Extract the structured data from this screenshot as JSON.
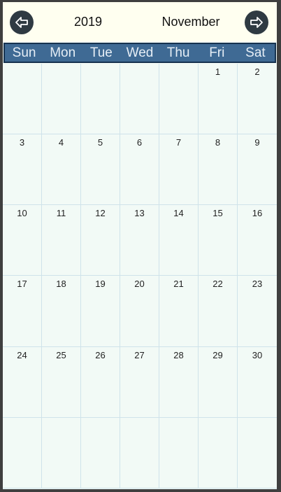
{
  "header": {
    "year": "2019",
    "month": "November",
    "prev_icon": "arrow-left-icon",
    "next_icon": "arrow-right-icon"
  },
  "weekdays": [
    "Sun",
    "Mon",
    "Tue",
    "Wed",
    "Thu",
    "Fri",
    "Sat"
  ],
  "weeks": [
    [
      "",
      "",
      "",
      "",
      "",
      "1",
      "2"
    ],
    [
      "3",
      "4",
      "5",
      "6",
      "7",
      "8",
      "9"
    ],
    [
      "10",
      "11",
      "12",
      "13",
      "14",
      "15",
      "16"
    ],
    [
      "17",
      "18",
      "19",
      "20",
      "21",
      "22",
      "23"
    ],
    [
      "24",
      "25",
      "26",
      "27",
      "28",
      "29",
      "30"
    ],
    [
      "",
      "",
      "",
      "",
      "",
      "",
      ""
    ]
  ],
  "colors": {
    "header_bg": "#fffff0",
    "weekday_bar": "#3f6a94",
    "grid_bg": "#f2faf6",
    "nav_button": "#2f3a42"
  }
}
